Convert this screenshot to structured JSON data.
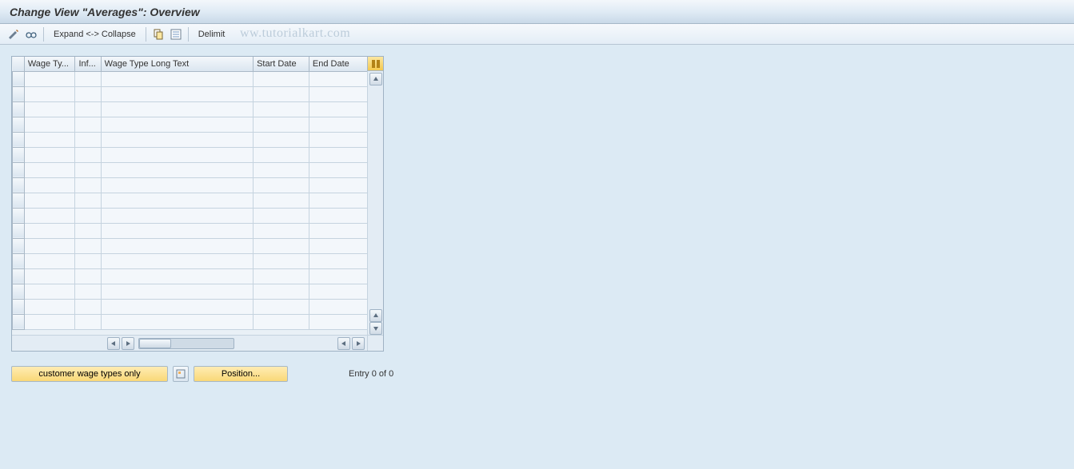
{
  "title": "Change View \"Averages\": Overview",
  "toolbar": {
    "expand_collapse": "Expand <-> Collapse",
    "delimit": "Delimit"
  },
  "watermark": "ww.tutorialkart.com",
  "table": {
    "columns": {
      "wage_type": "Wage Ty...",
      "inf": "Inf...",
      "long_text": "Wage Type Long Text",
      "start_date": "Start Date",
      "end_date": "End Date"
    },
    "row_count": 17
  },
  "footer": {
    "customer_button": "customer wage types only",
    "position_button": "Position...",
    "entry_text": "Entry 0 of 0"
  }
}
